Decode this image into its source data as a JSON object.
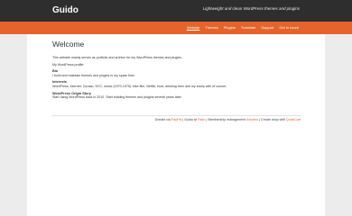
{
  "header": {
    "site_title": "Guido",
    "tagline": "Lightweight and clean WordPress themes and plugins"
  },
  "nav": {
    "items": [
      {
        "label": "Website",
        "active": true
      },
      {
        "label": "Themes",
        "active": false
      },
      {
        "label": "Plugins",
        "active": false
      },
      {
        "label": "Translate",
        "active": false
      },
      {
        "label": "Support",
        "active": false
      },
      {
        "label": "Get in touch",
        "active": false
      }
    ]
  },
  "main": {
    "title": "Welcome",
    "intro": "This website mainly serves as portfolio and archive for my WordPress themes and plugins.",
    "profile_line": "My WordPress profile:",
    "bio_heading": "Bio",
    "bio_text": "I build and maintain themes and plugins in my spare time.",
    "interests_heading": "Interests",
    "interests_text": "WordPress, internet, Curaao, NYC, music (1970-1975), bike film, Netflix, food, drinking beer and my lovely wife of course.",
    "origin_heading": "WordPress Origin Story",
    "origin_text": "Start using WordPress back in 2010. Start building themes and plugins several years later."
  },
  "footer": {
    "prefix": "Donate via",
    "paypal": "PayPal",
    "sep1": "| Guido at",
    "flickr": "Flickr",
    "sep2": "| Membership management",
    "advanto": "Advanto",
    "sep3": "| Create shop with",
    "qodecart": "QuickCart"
  }
}
